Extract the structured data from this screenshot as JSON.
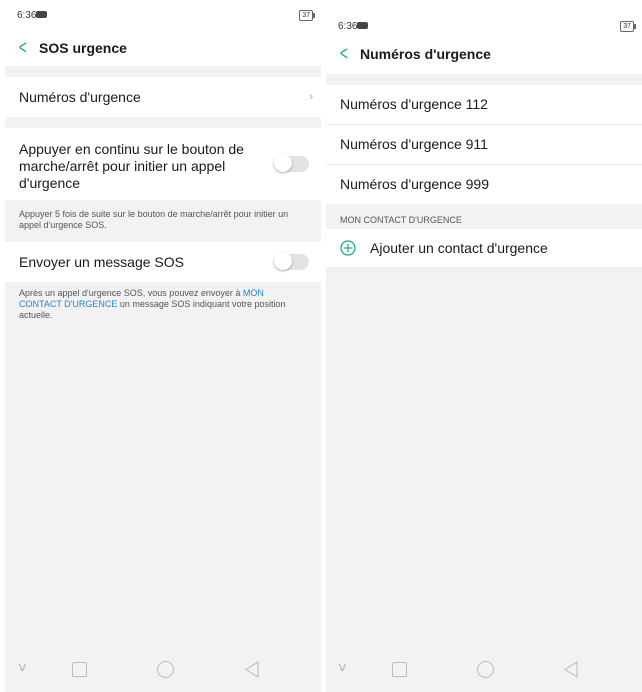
{
  "left": {
    "status": {
      "time": "6:36",
      "battery": "37"
    },
    "header": {
      "title": "SOS urgence"
    },
    "emergency_numbers_row": {
      "label": "Numéros d'urgence",
      "chevron": "›"
    },
    "power_button_row": {
      "label": "Appuyer en continu sur le bouton de marche/arrêt pour initier un appel d'urgence",
      "toggle_on": false
    },
    "power_note": "Appuyer 5 fois de suite sur le bouton de marche/arrêt pour initier un appel d'urgence SOS.",
    "sos_message_row": {
      "label": "Envoyer un message SOS",
      "toggle_on": false
    },
    "sos_note": {
      "before": "Après un appel d'urgence SOS, vous pouvez envoyer à ",
      "link": "MON CONTACT D'URGENCE",
      "after": " un message SOS indiquant votre position actuelle."
    }
  },
  "right": {
    "status": {
      "time": "6:36",
      "battery": "37"
    },
    "header": {
      "title": "Numéros d'urgence"
    },
    "numbers": [
      "Numéros d'urgence 112",
      "Numéros d'urgence 911",
      "Numéros d'urgence 999"
    ],
    "contact_section": {
      "header": "MON CONTACT D'URGENCE",
      "add_label": "Ajouter un contact d'urgence"
    }
  },
  "colors": {
    "accent": "#17a887",
    "link": "#1f86d6",
    "background": "#f2f2f2"
  },
  "icons": {
    "back": "back-chevron-icon",
    "add": "plus-circle-icon",
    "nav": [
      "nav-collapse-icon",
      "recents-icon",
      "home-icon",
      "back-icon"
    ]
  }
}
